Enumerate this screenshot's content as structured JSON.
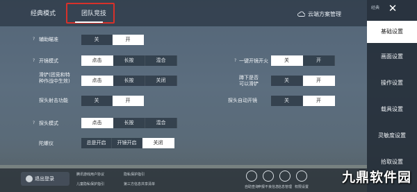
{
  "tabs": {
    "classic": "经典模式",
    "team": "团队竞技"
  },
  "cloud_label": "云端方案管理",
  "help_mark": "?",
  "settings": {
    "aim_assist": {
      "label": "辅助瞄准",
      "options": [
        "关",
        "开"
      ]
    },
    "scope_mode": {
      "label": "开镜模式",
      "options": [
        "点击",
        "长按",
        "混合"
      ]
    },
    "slide": {
      "label": "滑铲(团竞和特\n种作战中生效)",
      "options": [
        "点击",
        "长按",
        "关闭"
      ]
    },
    "peek_fire": {
      "label": "探头射击功能",
      "options": [
        "关",
        "开"
      ]
    },
    "peek_mode": {
      "label": "探头模式",
      "options": [
        "点击",
        "长按",
        "混合"
      ]
    },
    "gyro": {
      "label": "陀螺仪",
      "options": [
        "总是开启",
        "开镜开启",
        "关闭"
      ]
    },
    "one_key_scope_fire": {
      "label": "一键开镜开火",
      "options": [
        "关",
        "开"
      ]
    },
    "crouch_slide": {
      "label": "蹲下是否\n可以滑铲",
      "options": [
        "关",
        "开"
      ]
    },
    "peek_auto_scope": {
      "label": "探头自动开镜",
      "options": [
        "关",
        "开"
      ]
    }
  },
  "sidebar": {
    "header": "经典",
    "items": [
      "基础设置",
      "画面设置",
      "操作设置",
      "载具设置",
      "灵敏度设置",
      "拾取设置"
    ],
    "active": "基础设置"
  },
  "bottom": {
    "logout": "退出登录",
    "links": [
      "腾讯游戏用户协议",
      "隐私保护指引",
      "儿童隐私保护指引",
      "第三方信息共享清单"
    ],
    "icons": [
      {
        "name": "search",
        "label": "自助查询"
      },
      {
        "name": "report",
        "label": "申报不良信息"
      },
      {
        "name": "info",
        "label": "信息管理"
      },
      {
        "name": "privacy",
        "label": "权限设置"
      }
    ]
  },
  "watermark": "九鼎软件园",
  "colors": {
    "highlight_box": "#d8312a",
    "selected_option": "#ffffff"
  }
}
